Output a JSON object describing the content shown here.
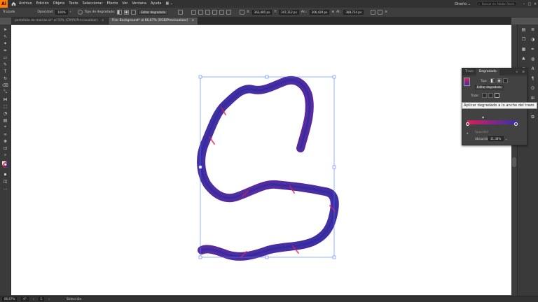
{
  "menubar": {
    "logo": "Ai",
    "items": [
      "Archivo",
      "Edición",
      "Objeto",
      "Texto",
      "Seleccionar",
      "Efecto",
      "Ver",
      "Ventana",
      "Ayuda"
    ],
    "workspace": "Diseño ⌄",
    "stock_search_placeholder": "Buscar en Adobe Stock"
  },
  "control": {
    "selection_label": "Trazado",
    "opacity_label": "Opacidad:",
    "opacity_value": "100%",
    "gradient_type_label": "Tipo de degradado:",
    "edit_gradient_label": "Editar degradado",
    "x_label": "X:",
    "x_value": "363,485 px",
    "y_label": "Y:",
    "y_value": "347,312 px",
    "w_label": "An.:",
    "w_value": "306,429 px",
    "h_label": "Al.:",
    "h_value": "388,734 px"
  },
  "tabs": [
    {
      "label": "portafolio de marcas.ai* al 50% (CMYK/Previsualizar)",
      "close": "×"
    },
    {
      "label": "Flier Background* al 66,67% (RGB/Previsualizar)",
      "close": "×"
    }
  ],
  "panel": {
    "tabs": [
      "Trazo",
      "Degradado"
    ],
    "type_label": "Tipo:",
    "edit_gradient": "Editar degradado",
    "stroke_label": "Trazo:",
    "opacity_label": "Opacidad",
    "location_label": "Ubicación:",
    "location_value": "31,38%"
  },
  "tooltip": "Aplicar degradado a lo ancho del trazo",
  "status": {
    "zoom": "66,67%",
    "rotation": "0°",
    "artboard": "1",
    "tool": "Selección"
  },
  "colors": {
    "gradient_start": "#d51f5b",
    "gradient_end": "#3a2fa6",
    "ui_dark": "#323232",
    "accent": "#ff7c00"
  }
}
